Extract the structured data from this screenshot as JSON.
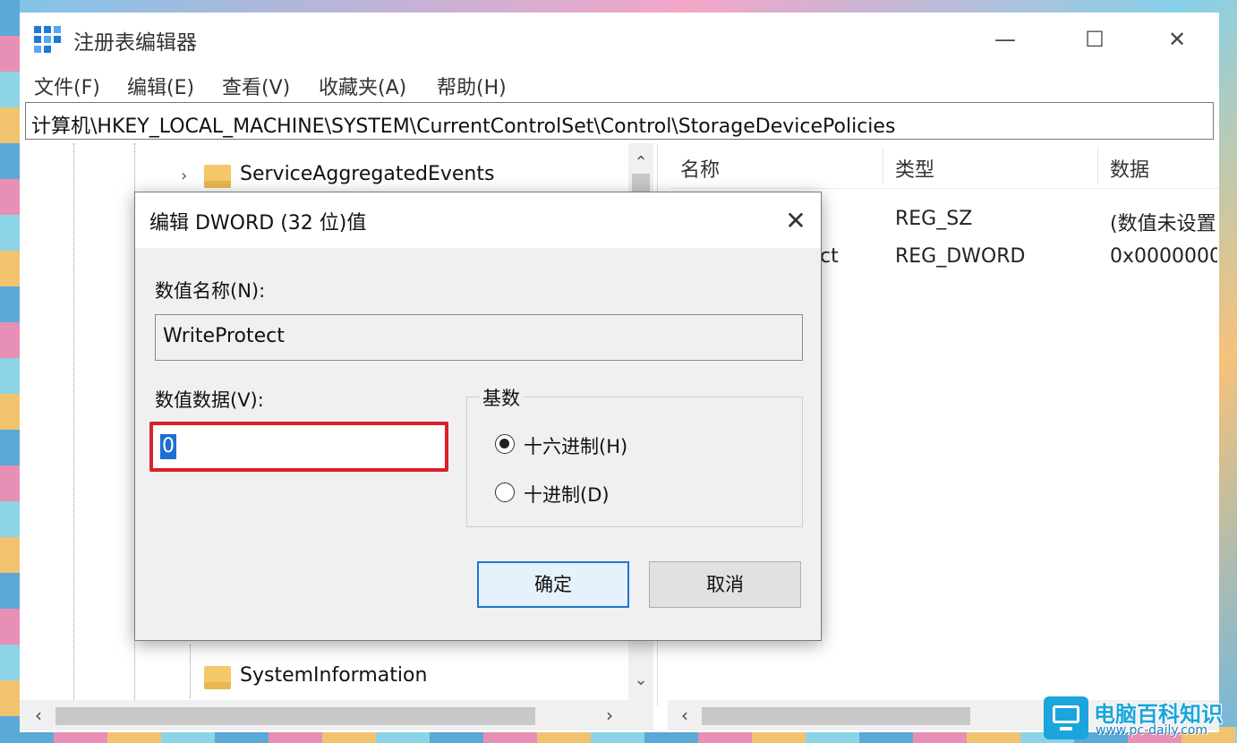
{
  "window": {
    "title": "注册表编辑器",
    "minimize_label": "—",
    "maximize_label": "☐",
    "close_label": "✕"
  },
  "menu": {
    "items": [
      {
        "label": "文件(F)"
      },
      {
        "label": "编辑(E)"
      },
      {
        "label": "查看(V)"
      },
      {
        "label": "收藏夹(A)"
      },
      {
        "label": "帮助(H)"
      }
    ]
  },
  "address": {
    "path": "计算机\\HKEY_LOCAL_MACHINE\\SYSTEM\\CurrentControlSet\\Control\\StorageDevicePolicies"
  },
  "tree": {
    "items": [
      {
        "label": "ServiceAggregatedEvents"
      },
      {
        "label": "SystemInformation"
      }
    ]
  },
  "list": {
    "columns": [
      "名称",
      "类型",
      "数据"
    ],
    "rows": [
      {
        "name": "",
        "type": "REG_SZ",
        "data": "(数值未设置"
      },
      {
        "name": "ct",
        "type": "REG_DWORD",
        "data": "0x0000000"
      }
    ]
  },
  "dialog": {
    "title": "编辑 DWORD (32 位)值",
    "close_label": "✕",
    "value_name_label": "数值名称(N):",
    "value_name": "WriteProtect",
    "value_data_label": "数值数据(V):",
    "value_data": "0",
    "base_title": "基数",
    "radios": [
      {
        "label": "十六进制(H)",
        "checked": true
      },
      {
        "label": "十进制(D)",
        "checked": false
      }
    ],
    "ok_label": "确定",
    "cancel_label": "取消"
  },
  "watermark": {
    "title": "电脑百科知识",
    "url": "www.pc-daily.com"
  },
  "colors": {
    "accent": "#1e74d0",
    "highlight_border": "#d9202a",
    "watermark": "#1aa5dd"
  }
}
